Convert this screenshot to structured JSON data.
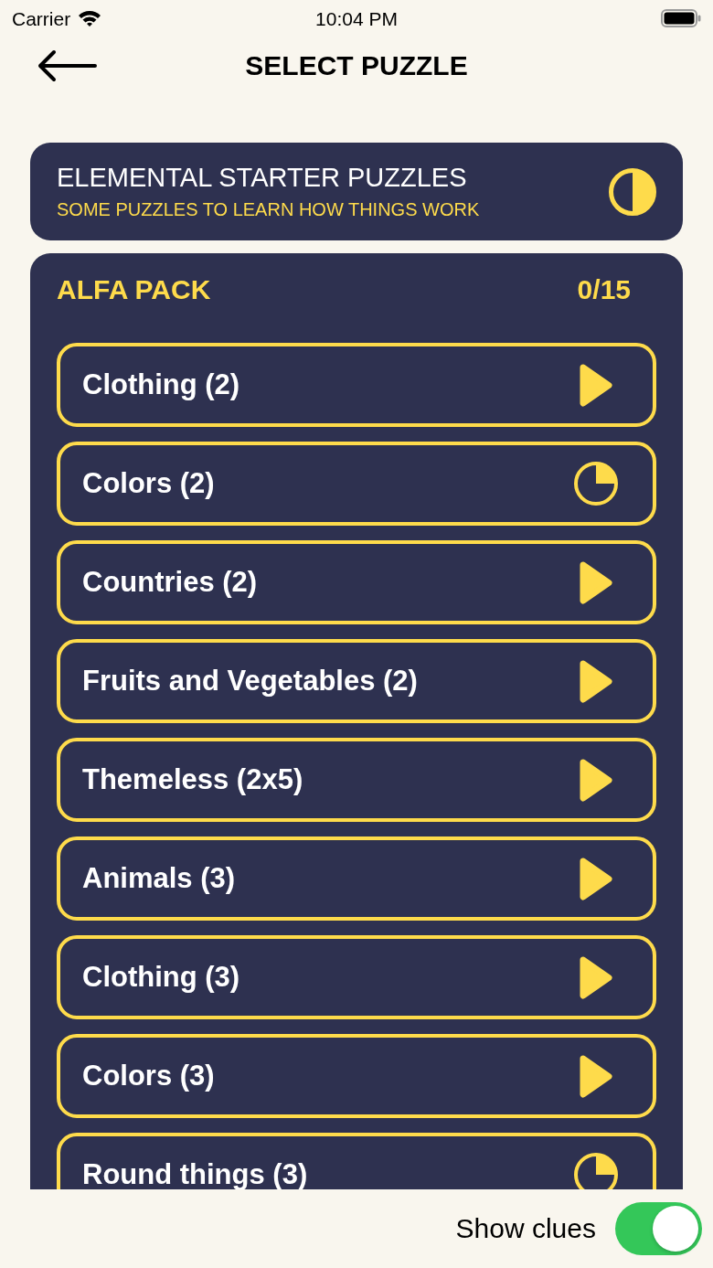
{
  "status_bar": {
    "carrier": "Carrier",
    "time": "10:04 PM"
  },
  "header": {
    "title": "SELECT PUZZLE"
  },
  "starter": {
    "title": "ELEMENTAL STARTER PUZZLES",
    "subtitle": "SOME PUZZLES TO LEARN HOW THINGS WORK",
    "level": 0.5
  },
  "pack": {
    "title": "ALFA PACK",
    "count": "0/15",
    "puzzles": [
      {
        "label": "Clothing (2)",
        "kind": "play"
      },
      {
        "label": "Colors (2)",
        "kind": "started"
      },
      {
        "label": "Countries (2)",
        "kind": "play"
      },
      {
        "label": "Fruits and Vegetables (2)",
        "kind": "play"
      },
      {
        "label": "Themeless (2x5)",
        "kind": "play"
      },
      {
        "label": "Animals (3)",
        "kind": "play"
      },
      {
        "label": "Clothing (3)",
        "kind": "play"
      },
      {
        "label": "Colors (3)",
        "kind": "play"
      },
      {
        "label": "Round things (3)",
        "kind": "started"
      }
    ]
  },
  "show_clues": {
    "label": "Show clues",
    "on": true
  }
}
